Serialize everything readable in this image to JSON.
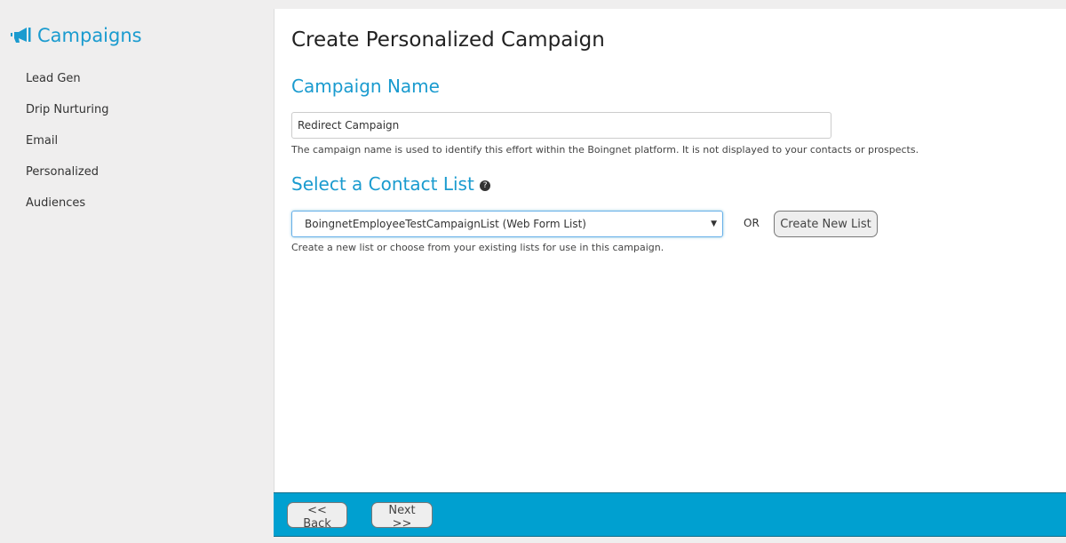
{
  "sidebar": {
    "title": "Campaigns",
    "icon": "megaphone-icon",
    "items": [
      {
        "label": "Lead Gen"
      },
      {
        "label": "Drip Nurturing"
      },
      {
        "label": "Email"
      },
      {
        "label": "Personalized"
      },
      {
        "label": "Audiences"
      }
    ]
  },
  "main": {
    "title": "Create Personalized Campaign",
    "name_heading": "Campaign Name",
    "name_value": "Redirect Campaign",
    "name_help": "The campaign name is used to identify this effort within the Boingnet platform. It is not displayed to your contacts or prospects.",
    "list_heading": "Select a Contact List",
    "list_selected": "BoingnetEmployeeTestCampaignList (Web Form List)",
    "or": "OR",
    "create_list": "Create New List",
    "list_help": "Create a new list or choose from your existing lists for use in this campaign."
  },
  "footer": {
    "back": "<< Back",
    "next": "Next >>"
  },
  "colors": {
    "accent": "#1a9bcf",
    "footer": "#00a0d0"
  }
}
